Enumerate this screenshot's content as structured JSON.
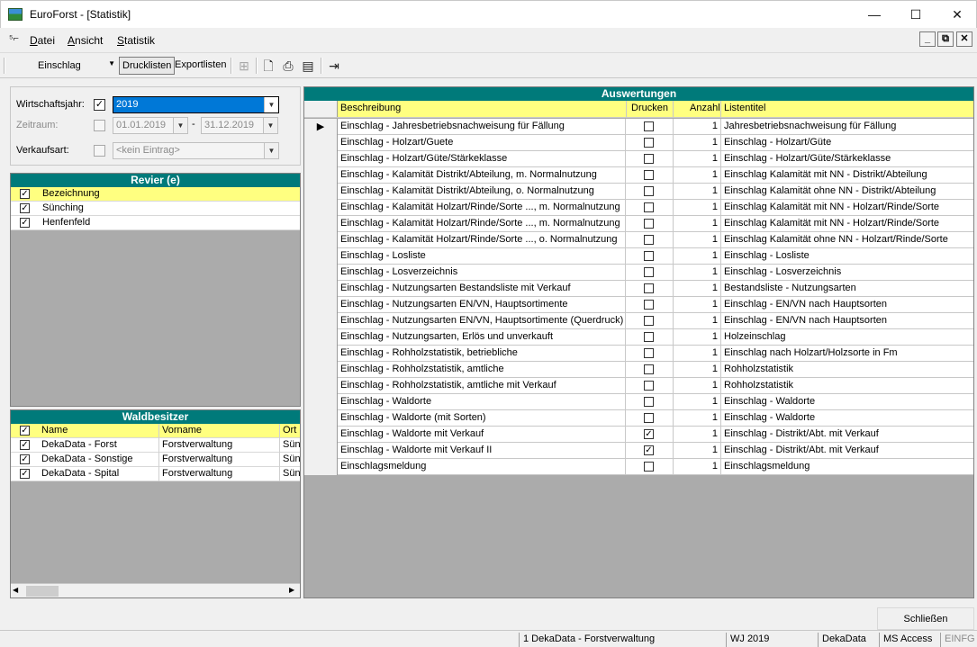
{
  "window": {
    "title": "EuroForst - [Statistik]",
    "controls": {
      "minimize": "—",
      "maximize": "☐",
      "close": "✕"
    }
  },
  "menu": {
    "items": [
      "Datei",
      "Ansicht",
      "Statistik"
    ],
    "mdi": {
      "minimize": "_",
      "restore": "⧉",
      "close": "✕"
    }
  },
  "toolbar": {
    "combo_value": "Einschlag",
    "tab_drucklisten": "Drucklisten",
    "tab_exportlisten": "Exportlisten"
  },
  "filters": {
    "wirtschaftsjahr_label": "Wirtschaftsjahr:",
    "wirtschaftsjahr_checked": true,
    "wirtschaftsjahr_value": "2019",
    "zeitraum_label": "Zeitraum:",
    "zeitraum_from": "01.01.2019",
    "zeitraum_dash": "-",
    "zeitraum_to": "31.12.2019",
    "verkaufsart_label": "Verkaufsart:",
    "verkaufsart_value": "<kein Eintrag>"
  },
  "revier": {
    "title": "Revier (e)",
    "header": "Bezeichnung",
    "rows": [
      {
        "name": "Sünching",
        "checked": true
      },
      {
        "name": "Henfenfeld",
        "checked": true
      }
    ]
  },
  "waldbesitzer": {
    "title": "Waldbesitzer",
    "headers": {
      "name": "Name",
      "vorname": "Vorname",
      "ort": "Ort"
    },
    "rows": [
      {
        "name": "DekaData - Forst",
        "vorname": "Forstverwaltung",
        "ort": "Süne"
      },
      {
        "name": "DekaData - Sonstige",
        "vorname": "Forstverwaltung",
        "ort": "Süne"
      },
      {
        "name": "DekaData - Spital",
        "vorname": "Forstverwaltung",
        "ort": "Süne"
      }
    ]
  },
  "auswertungen": {
    "title": "Auswertungen",
    "headers": {
      "beschreibung": "Beschreibung",
      "drucken": "Drucken",
      "anzahl": "Anzahl",
      "listentitel": "Listentitel"
    },
    "current_row_marker": "▶",
    "rows": [
      {
        "beschreibung": "Einschlag - Jahresbetriebsnachweisung für Fällung",
        "drucken": false,
        "anzahl": "1",
        "listentitel": "Jahresbetriebsnachweisung für Fällung"
      },
      {
        "beschreibung": "Einschlag - Holzart/Guete",
        "drucken": false,
        "anzahl": "1",
        "listentitel": "Einschlag - Holzart/Güte"
      },
      {
        "beschreibung": "Einschlag - Holzart/Güte/Stärkeklasse",
        "drucken": false,
        "anzahl": "1",
        "listentitel": "Einschlag - Holzart/Güte/Stärkeklasse"
      },
      {
        "beschreibung": "Einschlag - Kalamität Distrikt/Abteilung, m. Normalnutzung",
        "drucken": false,
        "anzahl": "1",
        "listentitel": "Einschlag Kalamität mit NN - Distrikt/Abteilung"
      },
      {
        "beschreibung": "Einschlag - Kalamität Distrikt/Abteilung, o. Normalnutzung",
        "drucken": false,
        "anzahl": "1",
        "listentitel": "Einschlag Kalamität ohne NN - Distrikt/Abteilung"
      },
      {
        "beschreibung": "Einschlag - Kalamität Holzart/Rinde/Sorte ..., m. Normalnutzung",
        "drucken": false,
        "anzahl": "1",
        "listentitel": "Einschlag Kalamität mit NN - Holzart/Rinde/Sorte"
      },
      {
        "beschreibung": "Einschlag - Kalamität Holzart/Rinde/Sorte ..., m. Normalnutzung",
        "drucken": false,
        "anzahl": "1",
        "listentitel": "Einschlag Kalamität mit NN - Holzart/Rinde/Sorte"
      },
      {
        "beschreibung": "Einschlag - Kalamität Holzart/Rinde/Sorte ..., o. Normalnutzung",
        "drucken": false,
        "anzahl": "1",
        "listentitel": "Einschlag Kalamität ohne NN - Holzart/Rinde/Sorte"
      },
      {
        "beschreibung": "Einschlag - Losliste",
        "drucken": false,
        "anzahl": "1",
        "listentitel": "Einschlag - Losliste"
      },
      {
        "beschreibung": "Einschlag - Losverzeichnis",
        "drucken": false,
        "anzahl": "1",
        "listentitel": "Einschlag - Losverzeichnis"
      },
      {
        "beschreibung": "Einschlag - Nutzungsarten Bestandsliste mit Verkauf",
        "drucken": false,
        "anzahl": "1",
        "listentitel": "Bestandsliste - Nutzungsarten"
      },
      {
        "beschreibung": "Einschlag - Nutzungsarten EN/VN, Hauptsortimente",
        "drucken": false,
        "anzahl": "1",
        "listentitel": "Einschlag - EN/VN nach Hauptsorten"
      },
      {
        "beschreibung": "Einschlag - Nutzungsarten EN/VN, Hauptsortimente (Querdruck)",
        "drucken": false,
        "anzahl": "1",
        "listentitel": "Einschlag - EN/VN nach Hauptsorten"
      },
      {
        "beschreibung": "Einschlag - Nutzungsarten, Erlös und unverkauft",
        "drucken": false,
        "anzahl": "1",
        "listentitel": "Holzeinschlag"
      },
      {
        "beschreibung": "Einschlag - Rohholzstatistik, betriebliche",
        "drucken": false,
        "anzahl": "1",
        "listentitel": "Einschlag nach Holzart/Holzsorte in Fm"
      },
      {
        "beschreibung": "Einschlag - Rohholzstatistik, amtliche",
        "drucken": false,
        "anzahl": "1",
        "listentitel": "Rohholzstatistik"
      },
      {
        "beschreibung": "Einschlag - Rohholzstatistik, amtliche  mit Verkauf",
        "drucken": false,
        "anzahl": "1",
        "listentitel": "Rohholzstatistik"
      },
      {
        "beschreibung": "Einschlag - Waldorte",
        "drucken": false,
        "anzahl": "1",
        "listentitel": "Einschlag - Waldorte"
      },
      {
        "beschreibung": "Einschlag - Waldorte (mit Sorten)",
        "drucken": false,
        "anzahl": "1",
        "listentitel": "Einschlag - Waldorte"
      },
      {
        "beschreibung": "Einschlag - Waldorte mit Verkauf",
        "drucken": true,
        "anzahl": "1",
        "listentitel": "Einschlag - Distrikt/Abt. mit Verkauf"
      },
      {
        "beschreibung": "Einschlag - Waldorte mit Verkauf II",
        "drucken": true,
        "anzahl": "1",
        "listentitel": "Einschlag - Distrikt/Abt. mit Verkauf"
      },
      {
        "beschreibung": "Einschlagsmeldung",
        "drucken": false,
        "anzahl": "1",
        "listentitel": "Einschlagsmeldung"
      }
    ]
  },
  "close_button": "Schließen",
  "statusbar": {
    "owner": "1 DekaData - Forstverwaltung",
    "year": "WJ 2019",
    "company": "DekaData",
    "db": "MS Access",
    "mode": "EINFG"
  },
  "icons": {
    "check": "✓",
    "dropdown": "▼",
    "scroll_left": "◀",
    "scroll_right": "▶"
  },
  "colors": {
    "header_teal": "#007a7a",
    "highlight_yellow": "#ffff80",
    "selection_blue": "#0078d7"
  }
}
